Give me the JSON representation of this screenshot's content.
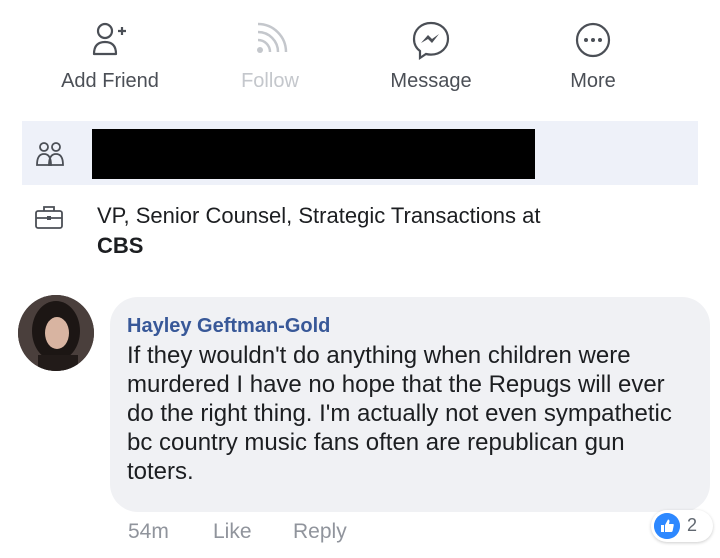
{
  "actions": [
    {
      "label": "Add Friend",
      "icon": "add-friend-icon",
      "enabled": true
    },
    {
      "label": "Follow",
      "icon": "follow-icon",
      "enabled": false
    },
    {
      "label": "Message",
      "icon": "messenger-icon",
      "enabled": true
    },
    {
      "label": "More",
      "icon": "more-icon",
      "enabled": true
    }
  ],
  "profile_info": {
    "mutual_icon": "mutual-friends-icon",
    "work_icon": "briefcase-icon",
    "work_title": "VP, Senior Counsel, Strategic Transactions at",
    "work_org": "CBS"
  },
  "comment": {
    "author": "Hayley Geftman-Gold",
    "text": "If they wouldn't do anything when children were murdered I have no hope that the Repugs will ever do the right thing.  I'm actually not even sympathetic bc country music fans often are republican gun toters.",
    "time": "54m",
    "like_label": "Like",
    "reply_label": "Reply",
    "reaction_count": "2",
    "reaction_icon": "like-reaction-icon"
  },
  "colors": {
    "author": "#385898",
    "meta": "#90949c",
    "bubble": "#f0f1f4",
    "highlight_row": "#eef1f9",
    "like_blue": "#2d88ff"
  }
}
